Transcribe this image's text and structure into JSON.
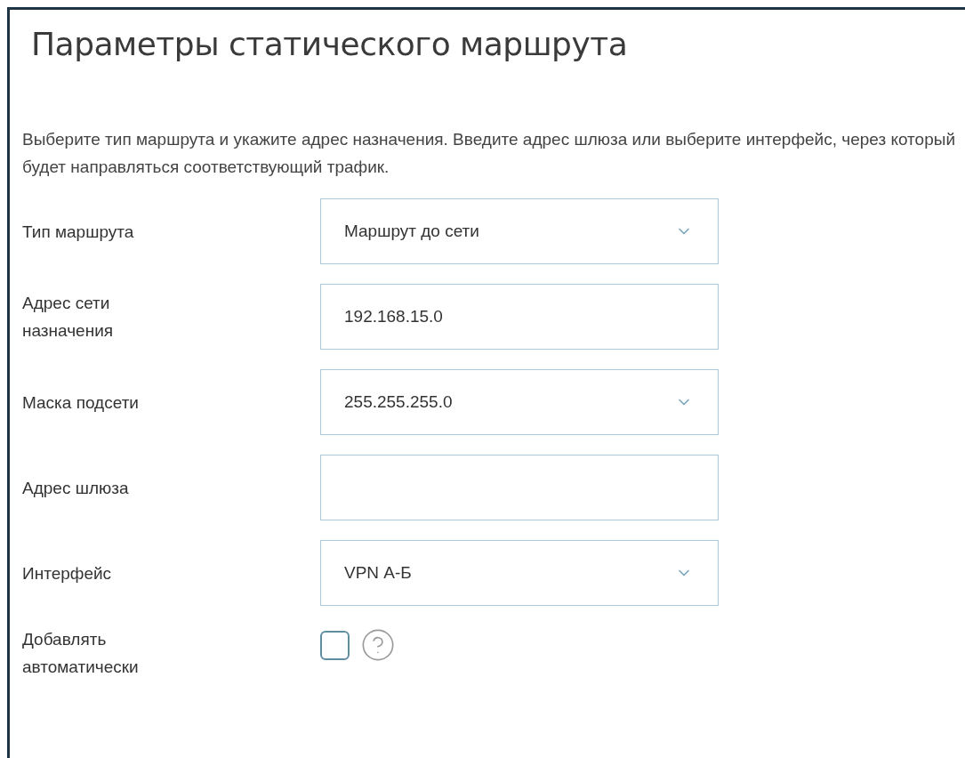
{
  "title": "Параметры статического маршрута",
  "description": "Выберите тип маршрута и укажите адрес назначения. Введите адрес шлюза или выберите интерфейс, через который будет направляться соответствующий трафик.",
  "fields": [
    {
      "kind": "select",
      "label": "Тип маршрута",
      "value": "Маршрут до сети"
    },
    {
      "kind": "input",
      "label": "Адрес сети назначения",
      "value": "192.168.15.0"
    },
    {
      "kind": "select",
      "label": "Маска подсети",
      "value": "255.255.255.0"
    },
    {
      "kind": "input",
      "label": "Адрес шлюза"
    },
    {
      "kind": "select",
      "label": "Интерфейс",
      "value": "VPN А-Б"
    },
    {
      "kind": "checkbox",
      "label": "Добавлять автоматически",
      "checked": false
    }
  ]
}
